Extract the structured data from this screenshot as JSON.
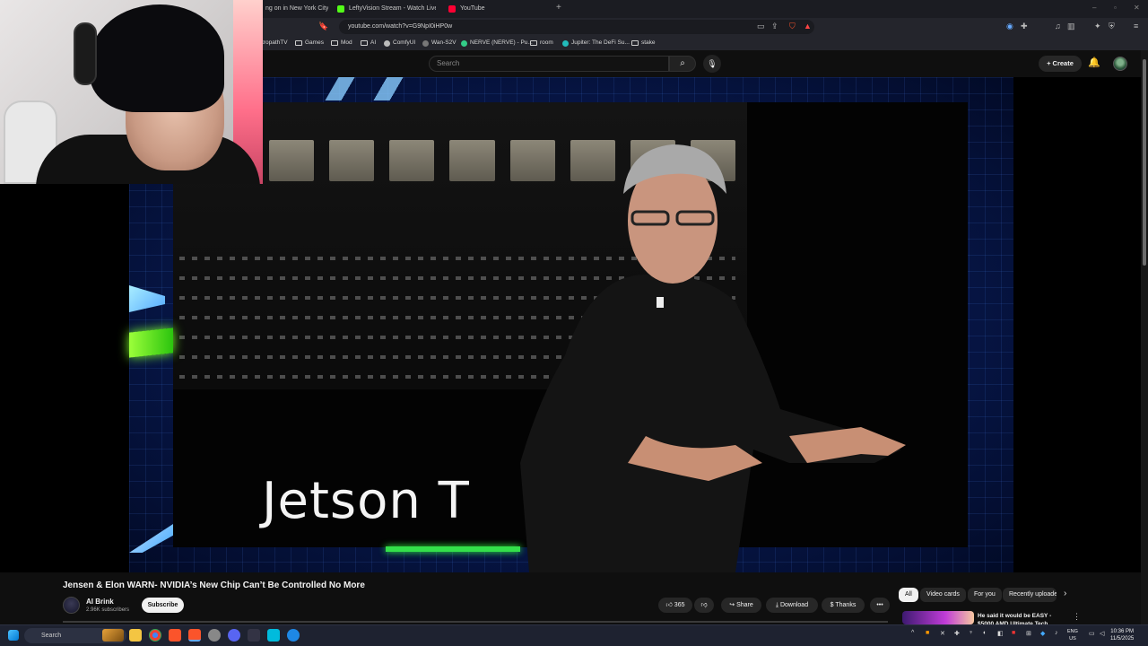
{
  "browser": {
    "tabs": [
      {
        "title": "ng on in New York City?",
        "color": "#888888"
      },
      {
        "title": "LeftyVision Stream - Watch Live on",
        "color": "#53fc18"
      },
      {
        "title": "YouTube",
        "color": "#ff0033"
      }
    ],
    "new_tab": "+",
    "url": "youtube.com/watch?v=G9NpI0iHP0w",
    "bookmarks": [
      {
        "label": "tropathTV",
        "icon": "folder"
      },
      {
        "label": "Games",
        "icon": "folder"
      },
      {
        "label": "Mod",
        "icon": "folder"
      },
      {
        "label": "AI",
        "icon": "folder"
      },
      {
        "label": "ComfyUI",
        "icon": "site"
      },
      {
        "label": "Wan-S2V",
        "icon": "site"
      },
      {
        "label": "NERVE (NERVE) - Pu...",
        "icon": "site"
      },
      {
        "label": "room",
        "icon": "folder"
      },
      {
        "label": "Jupiter: The DeFi Su...",
        "icon": "site"
      },
      {
        "label": "stake",
        "icon": "folder"
      }
    ]
  },
  "youtube": {
    "search_placeholder": "Search",
    "create_label": "Create",
    "video_caption": "Jetson T",
    "video_title": "Jensen & Elon WARN- NVIDIA’s New Chip Can’t Be Controlled No More",
    "channel_name": "AI Brink",
    "subscribers": "2.96K subscribers",
    "subscribe_label": "Subscribe",
    "like_count": "365",
    "share_label": "Share",
    "download_label": "Download",
    "thanks_label": "Thanks",
    "more_label": "•••",
    "filter_chips": [
      "All",
      "Video cards",
      "For you",
      "Recently uploaded"
    ],
    "recommended_title": "He said it would be EASY - $5000 AMD Ultimate Tech"
  },
  "taskbar": {
    "search_label": "Search",
    "lang_top": "ENG",
    "lang_bottom": "US",
    "time": "10:36 PM",
    "date": "11/5/2025"
  }
}
